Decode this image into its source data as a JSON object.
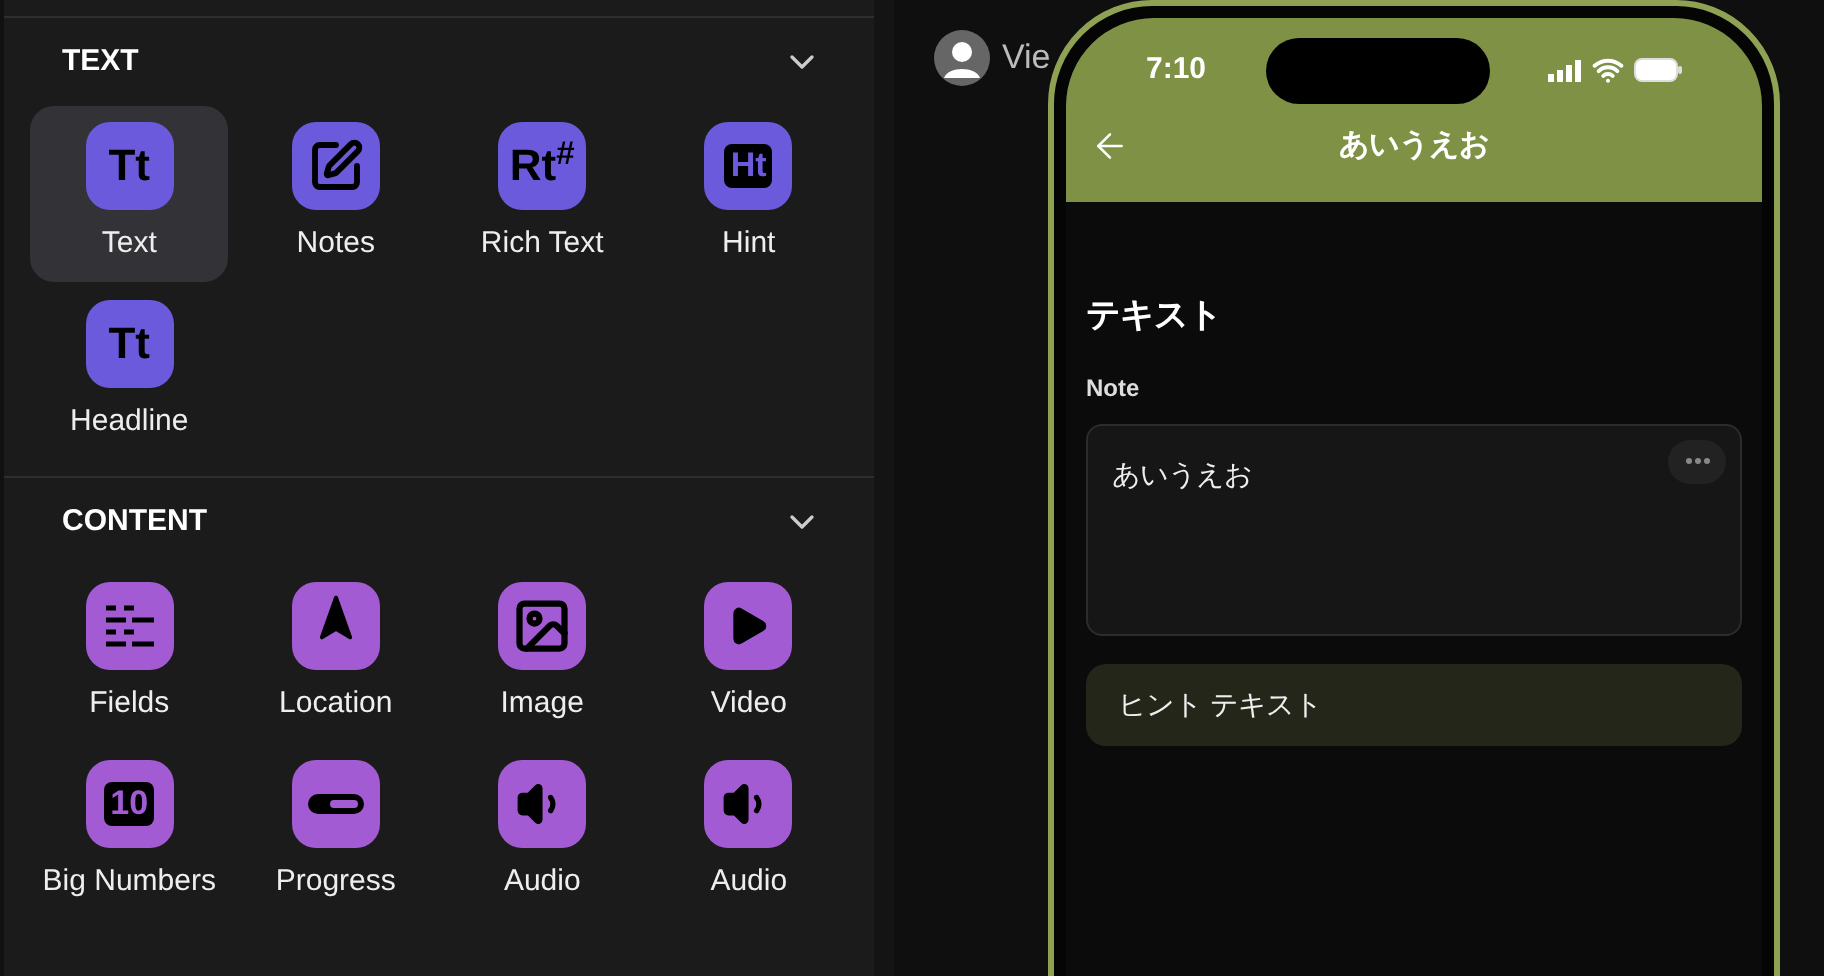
{
  "sections": [
    {
      "title": "TEXT",
      "expanded": true,
      "items": [
        {
          "kind": "glyph",
          "glyph": "Tt",
          "label": "Text",
          "selected": true,
          "color": "#6b5bdc"
        },
        {
          "kind": "notes",
          "label": "Notes",
          "selected": false,
          "color": "#6b5bdc"
        },
        {
          "kind": "glyph",
          "glyph": "Rt$^{#}$",
          "label": "Rich Text",
          "selected": false,
          "color": "#6b5bdc"
        },
        {
          "kind": "boxed",
          "glyph": "Ht",
          "label": "Hint",
          "selected": false,
          "color": "#6b5bdc"
        },
        {
          "kind": "glyph",
          "glyph": "Tt",
          "label": "Headline",
          "selected": false,
          "color": "#6b5bdc"
        }
      ]
    },
    {
      "title": "CONTENT",
      "expanded": true,
      "items": [
        {
          "kind": "fields",
          "label": "Fields",
          "selected": false,
          "color": "#a35bd4"
        },
        {
          "kind": "location",
          "label": "Location",
          "selected": false,
          "color": "#a35bd4"
        },
        {
          "kind": "image",
          "label": "Image",
          "selected": false,
          "color": "#a35bd4"
        },
        {
          "kind": "video",
          "label": "Video",
          "selected": false,
          "color": "#a35bd4"
        },
        {
          "kind": "boxed",
          "glyph": "10",
          "label": "Big Numbers",
          "selected": false,
          "color": "#a35bd4"
        },
        {
          "kind": "progress",
          "label": "Progress",
          "selected": false,
          "color": "#a35bd4"
        },
        {
          "kind": "audio",
          "label": "Audio",
          "selected": false,
          "color": "#a35bd4"
        },
        {
          "kind": "audio",
          "label": "Audio",
          "selected": false,
          "color": "#a35bd4"
        }
      ]
    }
  ],
  "viewer": {
    "label": "Vie"
  },
  "phone": {
    "time": "7:10",
    "title": "あいうえお",
    "heading": "テキスト",
    "note_label": "Note",
    "note_value": "あいうえお",
    "hint": "ヒント テキスト"
  }
}
